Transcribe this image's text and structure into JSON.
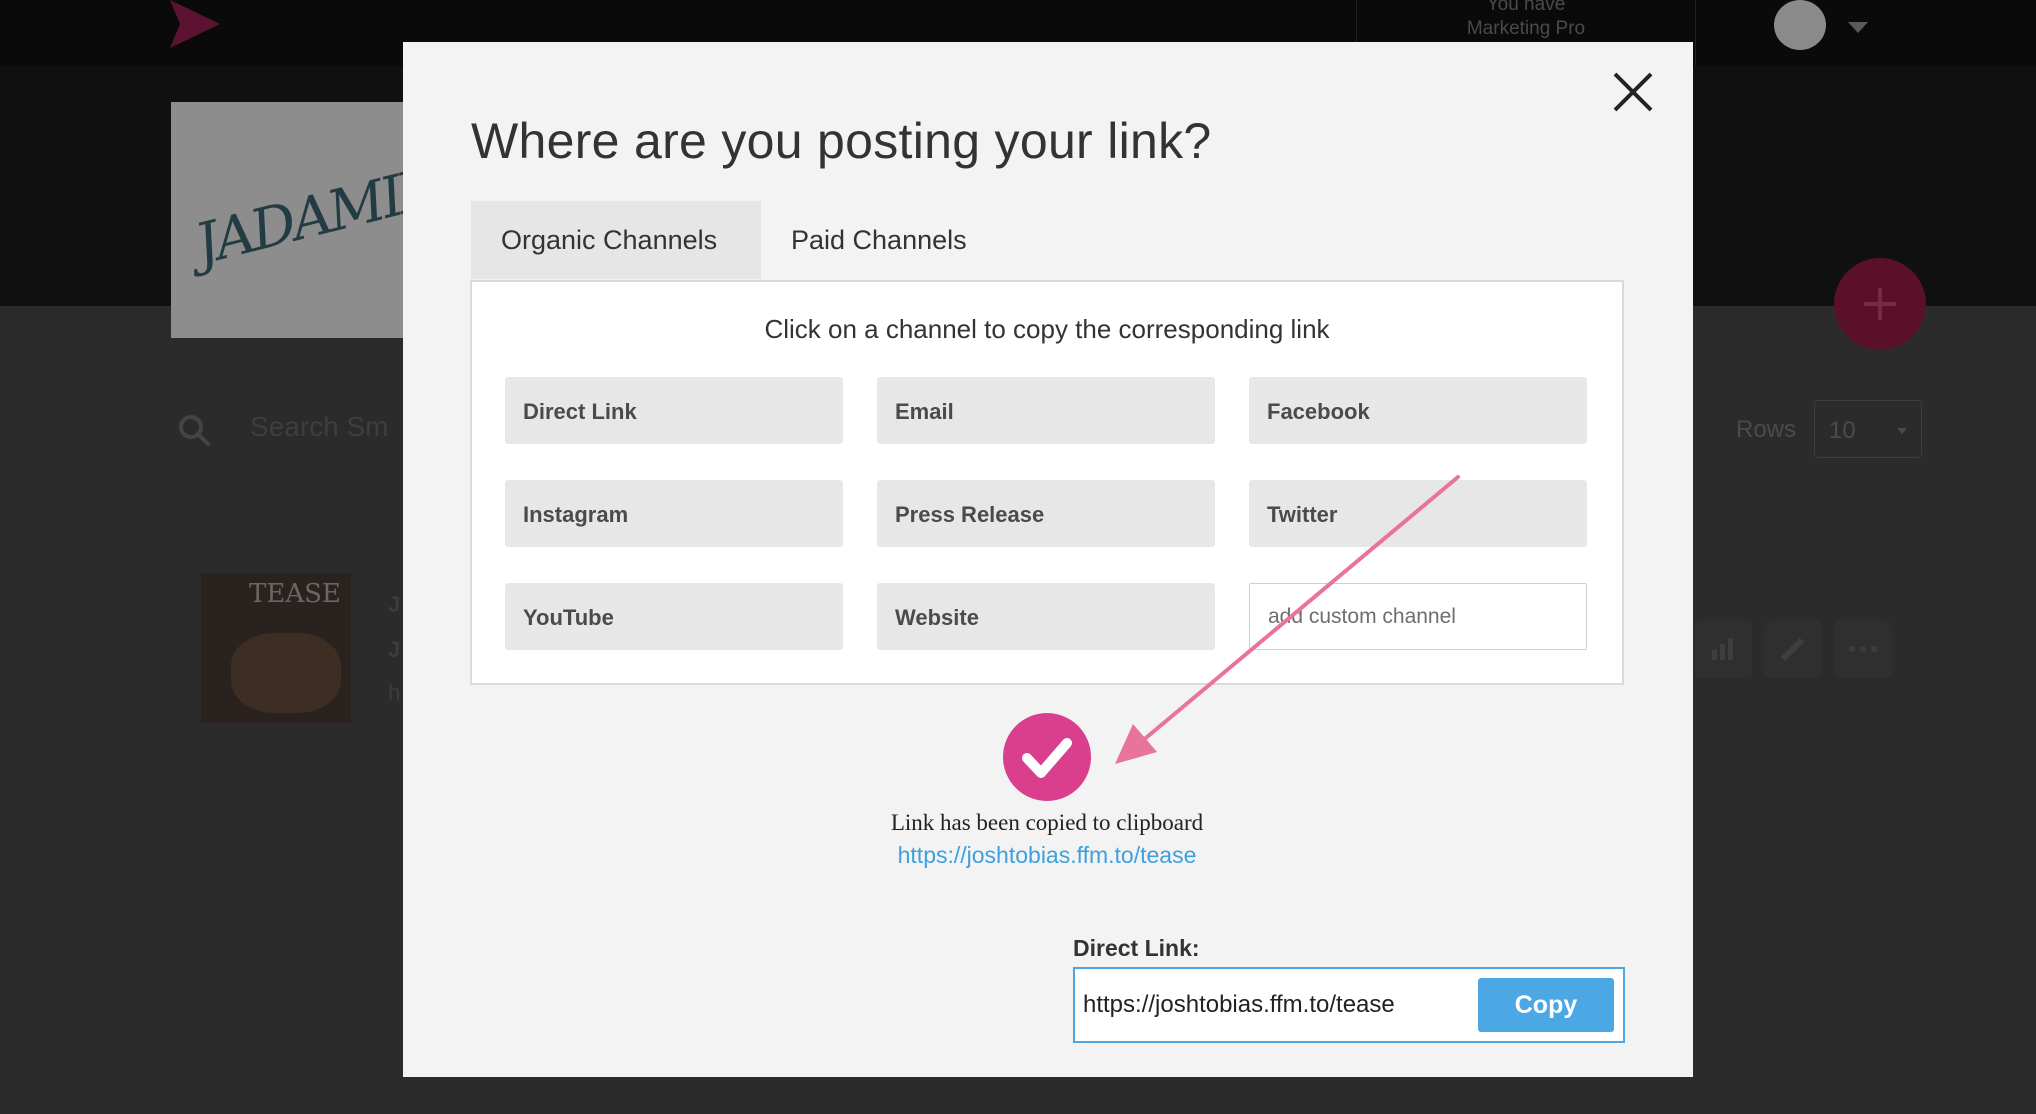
{
  "background": {
    "plan_line1": "You have",
    "plan_line2": "Marketing Pro",
    "artist_signature": "JADAMIX",
    "search_placeholder": "Search Sm",
    "rows_label": "Rows",
    "rows_value": "10",
    "release_thumb_text": "TEASE",
    "row_text_1": "J",
    "row_text_2": "J",
    "row_text_3": "h",
    "icons": [
      "logo-icon",
      "avatar-icon",
      "plus-icon",
      "search-icon",
      "bar-chart-icon",
      "pencil-icon",
      "more-icon"
    ]
  },
  "modal": {
    "title": "Where are you posting your link?",
    "tabs": [
      {
        "label": "Organic Channels",
        "active": true
      },
      {
        "label": "Paid Channels",
        "active": false
      }
    ],
    "hint": "Click on a channel to copy the corresponding link",
    "channels": [
      "Direct Link",
      "Email",
      "Facebook",
      "Instagram",
      "Press Release",
      "Twitter",
      "YouTube",
      "Website"
    ],
    "custom_channel_placeholder": "add custom channel",
    "copied_message": "Link has been copied to clipboard",
    "copied_url": "https://joshtobias.ffm.to/tease",
    "direct_link_label": "Direct Link:",
    "direct_link_value": "https://joshtobias.ffm.to/tease",
    "copy_label": "Copy"
  },
  "colors": {
    "accent_pink": "#da3f8e",
    "arrow_pink": "#e8739c",
    "link_blue": "#3ea0dc",
    "copy_button": "#4ba8e5"
  }
}
